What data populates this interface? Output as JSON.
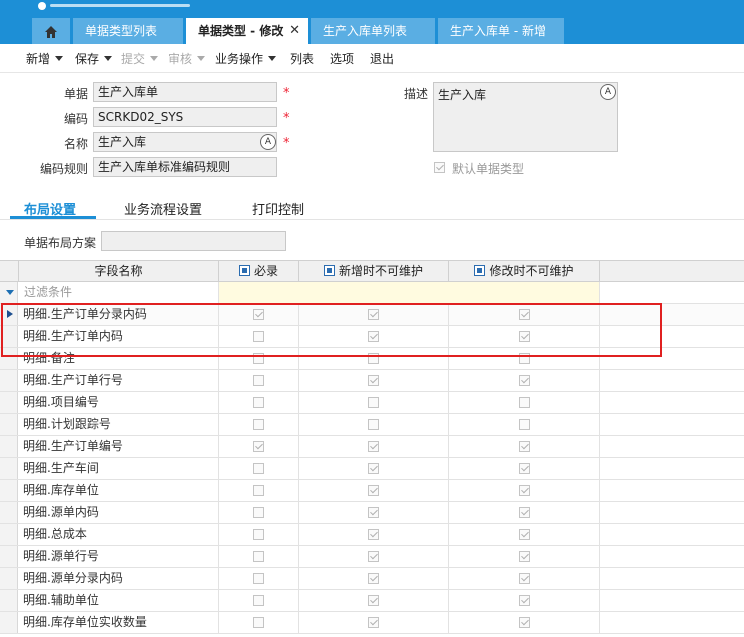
{
  "tabs": [
    {
      "label": "单据类型列表",
      "active": false
    },
    {
      "label": "单据类型 - 修改",
      "active": true,
      "closable": true
    },
    {
      "label": "生产入库单列表",
      "active": false
    },
    {
      "label": "生产入库单 - 新增",
      "active": false
    }
  ],
  "toolbar": {
    "new": "新增",
    "save": "保存",
    "submit": "提交",
    "audit": "审核",
    "business": "业务操作",
    "list": "列表",
    "options": "选项",
    "exit": "退出"
  },
  "form": {
    "bill_label": "单据",
    "bill_value": "生产入库单",
    "code_label": "编码",
    "code_value": "SCRKD02_SYS",
    "name_label": "名称",
    "name_value": "生产入库",
    "rule_label": "编码规则",
    "rule_value": "生产入库单标准编码规则",
    "desc_label": "描述",
    "desc_value": "生产入库",
    "default_label": "默认单据类型",
    "default_checked": true
  },
  "section_tabs": [
    "布局设置",
    "业务流程设置",
    "打印控制"
  ],
  "layout_scheme_label": "单据布局方案",
  "layout_scheme_value": "",
  "grid": {
    "headers": {
      "field": "字段名称",
      "required": "必录",
      "no_edit_new": "新增时不可维护",
      "no_edit_modify": "修改时不可维护"
    },
    "filter_label": "过滤条件",
    "rows": [
      {
        "field": "明细.生产订单分录内码",
        "required": true,
        "no_new": true,
        "no_modify": true
      },
      {
        "field": "明细.生产订单内码",
        "required": false,
        "no_new": true,
        "no_modify": true
      },
      {
        "field": "明细.备注",
        "required": false,
        "no_new": false,
        "no_modify": false
      },
      {
        "field": "明细.生产订单行号",
        "required": false,
        "no_new": true,
        "no_modify": true
      },
      {
        "field": "明细.项目编号",
        "required": false,
        "no_new": false,
        "no_modify": false
      },
      {
        "field": "明细.计划跟踪号",
        "required": false,
        "no_new": false,
        "no_modify": false
      },
      {
        "field": "明细.生产订单编号",
        "required": true,
        "no_new": true,
        "no_modify": true
      },
      {
        "field": "明细.生产车间",
        "required": false,
        "no_new": true,
        "no_modify": true
      },
      {
        "field": "明细.库存单位",
        "required": false,
        "no_new": true,
        "no_modify": true
      },
      {
        "field": "明细.源单内码",
        "required": false,
        "no_new": true,
        "no_modify": true
      },
      {
        "field": "明细.总成本",
        "required": false,
        "no_new": true,
        "no_modify": true
      },
      {
        "field": "明细.源单行号",
        "required": false,
        "no_new": true,
        "no_modify": true
      },
      {
        "field": "明细.源单分录内码",
        "required": false,
        "no_new": true,
        "no_modify": true
      },
      {
        "field": "明细.辅助单位",
        "required": false,
        "no_new": true,
        "no_modify": true
      },
      {
        "field": "明细.库存单位实收数量",
        "required": false,
        "no_new": true,
        "no_modify": true
      }
    ]
  },
  "colors": {
    "accent": "#1d8fd6",
    "highlight_box": "#e02020",
    "filter_row": "#fffbe0"
  }
}
